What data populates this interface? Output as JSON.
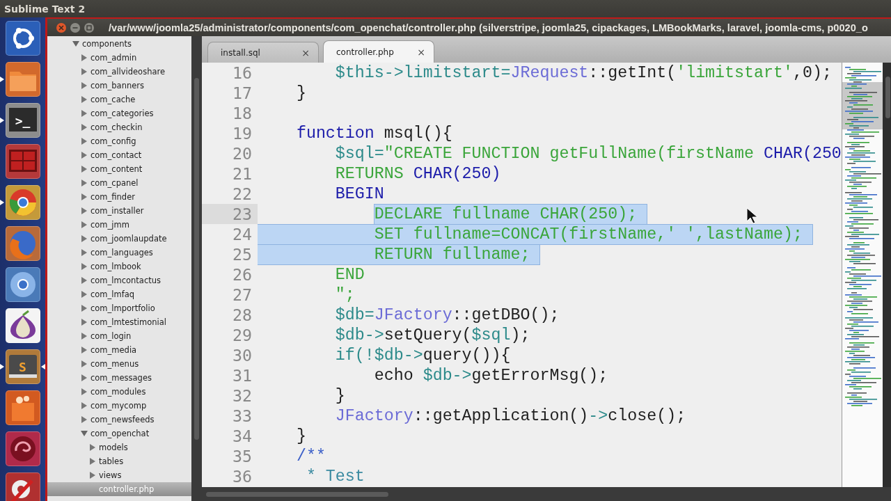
{
  "app_bar": {
    "title": "Sublime Text 2"
  },
  "launcher": [
    {
      "kind": "dash",
      "running": false,
      "selected": false
    },
    {
      "kind": "files",
      "running": true,
      "selected": false
    },
    {
      "kind": "terminal",
      "glyph": ">_",
      "running": true,
      "selected": false
    },
    {
      "kind": "workspaces",
      "running": false,
      "selected": false
    },
    {
      "kind": "chrome",
      "running": true,
      "selected": false
    },
    {
      "kind": "firefox",
      "running": false,
      "selected": false
    },
    {
      "kind": "chromium",
      "running": false,
      "selected": false
    },
    {
      "kind": "onion",
      "running": false,
      "selected": false
    },
    {
      "kind": "sublime",
      "glyph": "S",
      "running": true,
      "selected": true
    },
    {
      "kind": "bag",
      "running": false,
      "selected": false
    },
    {
      "kind": "swirl",
      "running": false,
      "selected": false
    },
    {
      "kind": "settings",
      "running": false,
      "selected": false
    }
  ],
  "window": {
    "title": "/var/www/joomla25/administrator/components/com_openchat/controller.php (silverstripe, joomla25, cipackages, LMBookMarks, laravel, joomla-cms, p0020_o"
  },
  "sidebar": {
    "tree": [
      {
        "label": "components",
        "kind": "folder",
        "expanded": true,
        "selected": false,
        "children": [
          {
            "label": "com_admin",
            "kind": "folder",
            "expanded": false,
            "selected": false
          },
          {
            "label": "com_allvideoshare",
            "kind": "folder",
            "expanded": false,
            "selected": false
          },
          {
            "label": "com_banners",
            "kind": "folder",
            "expanded": false,
            "selected": false
          },
          {
            "label": "com_cache",
            "kind": "folder",
            "expanded": false,
            "selected": false
          },
          {
            "label": "com_categories",
            "kind": "folder",
            "expanded": false,
            "selected": false
          },
          {
            "label": "com_checkin",
            "kind": "folder",
            "expanded": false,
            "selected": false
          },
          {
            "label": "com_config",
            "kind": "folder",
            "expanded": false,
            "selected": false
          },
          {
            "label": "com_contact",
            "kind": "folder",
            "expanded": false,
            "selected": false
          },
          {
            "label": "com_content",
            "kind": "folder",
            "expanded": false,
            "selected": false
          },
          {
            "label": "com_cpanel",
            "kind": "folder",
            "expanded": false,
            "selected": false
          },
          {
            "label": "com_finder",
            "kind": "folder",
            "expanded": false,
            "selected": false
          },
          {
            "label": "com_installer",
            "kind": "folder",
            "expanded": false,
            "selected": false
          },
          {
            "label": "com_jmm",
            "kind": "folder",
            "expanded": false,
            "selected": false
          },
          {
            "label": "com_joomlaupdate",
            "kind": "folder",
            "expanded": false,
            "selected": false
          },
          {
            "label": "com_languages",
            "kind": "folder",
            "expanded": false,
            "selected": false
          },
          {
            "label": "com_lmbook",
            "kind": "folder",
            "expanded": false,
            "selected": false
          },
          {
            "label": "com_lmcontactus",
            "kind": "folder",
            "expanded": false,
            "selected": false
          },
          {
            "label": "com_lmfaq",
            "kind": "folder",
            "expanded": false,
            "selected": false
          },
          {
            "label": "com_lmportfolio",
            "kind": "folder",
            "expanded": false,
            "selected": false
          },
          {
            "label": "com_lmtestimonial",
            "kind": "folder",
            "expanded": false,
            "selected": false
          },
          {
            "label": "com_login",
            "kind": "folder",
            "expanded": false,
            "selected": false
          },
          {
            "label": "com_media",
            "kind": "folder",
            "expanded": false,
            "selected": false
          },
          {
            "label": "com_menus",
            "kind": "folder",
            "expanded": false,
            "selected": false
          },
          {
            "label": "com_messages",
            "kind": "folder",
            "expanded": false,
            "selected": false
          },
          {
            "label": "com_modules",
            "kind": "folder",
            "expanded": false,
            "selected": false
          },
          {
            "label": "com_mycomp",
            "kind": "folder",
            "expanded": false,
            "selected": false
          },
          {
            "label": "com_newsfeeds",
            "kind": "folder",
            "expanded": false,
            "selected": false
          },
          {
            "label": "com_openchat",
            "kind": "folder",
            "expanded": true,
            "selected": false,
            "children": [
              {
                "label": "models",
                "kind": "folder",
                "expanded": false,
                "selected": false
              },
              {
                "label": "tables",
                "kind": "folder",
                "expanded": false,
                "selected": false
              },
              {
                "label": "views",
                "kind": "folder",
                "expanded": false,
                "selected": false
              },
              {
                "label": "controller.php",
                "kind": "file",
                "selected": true
              }
            ]
          }
        ]
      }
    ]
  },
  "tabs": [
    {
      "label": "install.sql",
      "close": "×",
      "selected": false
    },
    {
      "label": "controller.php",
      "close": "×",
      "selected": true
    }
  ],
  "editor": {
    "lines": [
      {
        "number": "16",
        "current": false,
        "selected": false,
        "tokens": [
          {
            "kind": "var",
            "text": "        $this->limitstart="
          },
          {
            "kind": "cls",
            "text": "JRequest"
          },
          {
            "kind": "plain",
            "text": "::getInt("
          },
          {
            "kind": "str",
            "text": "'limitstart'"
          },
          {
            "kind": "plain",
            "text": ",0);"
          }
        ]
      },
      {
        "number": "17",
        "current": false,
        "selected": false,
        "tokens": [
          {
            "kind": "plain",
            "text": "    }"
          }
        ]
      },
      {
        "number": "18",
        "current": false
      },
      {
        "number": "19",
        "current": false,
        "selected": false,
        "tokens": [
          {
            "kind": "kw",
            "text": "    function"
          },
          {
            "kind": "plain",
            "text": " msql(){"
          }
        ]
      },
      {
        "number": "20",
        "current": false,
        "selected": false,
        "tokens": [
          {
            "kind": "var",
            "text": "        $sql="
          },
          {
            "kind": "str",
            "text": "\"CREATE FUNCTION getFullName(firstName "
          },
          {
            "kind": "kw",
            "text": "CHAR(250"
          }
        ]
      },
      {
        "number": "21",
        "current": false,
        "selected": false,
        "tokens": [
          {
            "kind": "str",
            "text": "        RETURNS "
          },
          {
            "kind": "kw",
            "text": "CHAR(250)"
          }
        ]
      },
      {
        "number": "22",
        "current": false,
        "selected": false,
        "tokens": [
          {
            "kind": "kw",
            "text": "        BEGIN"
          }
        ]
      },
      {
        "number": "23",
        "current": true,
        "selected": true,
        "whole_line": false,
        "tokens": [
          {
            "kind": "str",
            "text": "            DECLARE fullname CHAR(250);"
          }
        ]
      },
      {
        "number": "24",
        "current": false,
        "selected": true,
        "whole_line": true,
        "tokens": [
          {
            "kind": "str",
            "text": "            SET fullname=CONCAT(firstName,' ',lastName);"
          }
        ]
      },
      {
        "number": "25",
        "current": false,
        "selected": true,
        "whole_line": true,
        "tokens": [
          {
            "kind": "str",
            "text": "            RETURN fullname;"
          }
        ]
      },
      {
        "number": "26",
        "current": false,
        "selected": false,
        "tokens": [
          {
            "kind": "str",
            "text": "        END"
          }
        ]
      },
      {
        "number": "27",
        "current": false,
        "selected": false,
        "tokens": [
          {
            "kind": "str",
            "text": "        \";"
          }
        ]
      },
      {
        "number": "28",
        "current": false,
        "selected": false,
        "tokens": [
          {
            "kind": "var",
            "text": "        $db="
          },
          {
            "kind": "cls",
            "text": "JFactory"
          },
          {
            "kind": "plain",
            "text": "::getDBO();"
          }
        ]
      },
      {
        "number": "29",
        "current": false,
        "selected": false,
        "tokens": [
          {
            "kind": "var",
            "text": "        $db->"
          },
          {
            "kind": "plain",
            "text": "setQuery("
          },
          {
            "kind": "var",
            "text": "$sql"
          },
          {
            "kind": "plain",
            "text": ");"
          }
        ]
      },
      {
        "number": "30",
        "current": false,
        "selected": false,
        "tokens": [
          {
            "kind": "var",
            "text": "        if(!$db->"
          },
          {
            "kind": "plain",
            "text": "query()){"
          }
        ]
      },
      {
        "number": "31",
        "current": false,
        "selected": false,
        "tokens": [
          {
            "kind": "plain",
            "text": "            echo "
          },
          {
            "kind": "var",
            "text": "$db->"
          },
          {
            "kind": "plain",
            "text": "getErrorMsg();"
          }
        ]
      },
      {
        "number": "32",
        "current": false,
        "selected": false,
        "tokens": [
          {
            "kind": "plain",
            "text": "        }"
          }
        ]
      },
      {
        "number": "33",
        "current": false,
        "selected": false,
        "tokens": [
          {
            "kind": "cls",
            "text": "        JFactory"
          },
          {
            "kind": "plain",
            "text": "::getApplication()"
          },
          {
            "kind": "var",
            "text": "->"
          },
          {
            "kind": "plain",
            "text": "close();"
          }
        ]
      },
      {
        "number": "34",
        "current": false,
        "selected": false,
        "tokens": [
          {
            "kind": "plain",
            "text": "    }"
          }
        ]
      },
      {
        "number": "35",
        "current": false,
        "selected": false,
        "tokens": [
          {
            "kind": "doc",
            "text": "    /**"
          }
        ]
      },
      {
        "number": "36",
        "current": false,
        "selected": false,
        "tokens": [
          {
            "kind": "doc2",
            "text": "     * Test"
          }
        ]
      }
    ]
  }
}
